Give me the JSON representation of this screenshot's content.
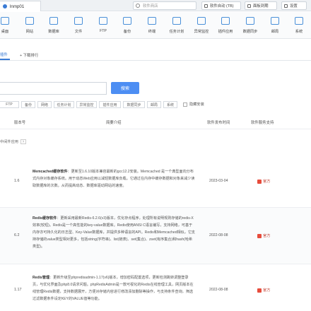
{
  "topbar": {
    "host_tab": "lnmp01",
    "search_placeholder": "软件商店",
    "btn_software_update": "软件自动 (TB)",
    "btn_fav": "面板到期",
    "btn_settings": "设置"
  },
  "toolbar": [
    {
      "label": "桌面",
      "icon": "desktop-icon"
    },
    {
      "label": "网站",
      "icon": "globe-icon"
    },
    {
      "label": "数据库",
      "icon": "database-icon"
    },
    {
      "label": "文件",
      "icon": "folder-icon"
    },
    {
      "label": "FTP",
      "icon": "ftp-icon"
    },
    {
      "label": "备份",
      "icon": "backup-icon"
    },
    {
      "label": "终端",
      "icon": "terminal-icon"
    },
    {
      "label": "任务计划",
      "icon": "clock-icon"
    },
    {
      "label": "异常监控",
      "icon": "monitor-icon"
    },
    {
      "label": "插件应用",
      "icon": "plugin-icon"
    },
    {
      "label": "数据同步",
      "icon": "sync-icon"
    },
    {
      "label": "邮局",
      "icon": "mail-icon"
    },
    {
      "label": "系统",
      "icon": "system-icon"
    }
  ],
  "subtabs": {
    "tab1": "插件",
    "tab2": "+ 下载排行"
  },
  "search": {
    "button": "搜索"
  },
  "chips": [
    "FTP",
    "备份",
    "网络",
    "任务计划",
    "异常监控",
    "插件应用",
    "数据同步",
    "邮局",
    "系统"
  ],
  "checkbox_label": "隐藏安装",
  "table": {
    "col_version": "版本号",
    "col_desc": "简要介绍",
    "col_date": "软件发布时间",
    "col_vendor": "软件服务支持"
  },
  "category": {
    "label": "中间件应用",
    "badge": "?"
  },
  "rows": [
    {
      "version": "1.6",
      "title": "Memcached缓存软件",
      "text": "：更新至1.6.10版本兼容最新的gcc12.2安装。Memcached 是一个典型面向分布式内存对象缓存系统。用于动态Web应用以减轻数据库负载。它通过在内存中缓存数据和对象来减少读取数据库的次数。从而提高动态、数据库驱动网站的速度。",
      "date": "2023-03-04",
      "vendor": "官方"
    },
    {
      "version": "6.2",
      "title": "Redis缓存软件",
      "text": "：更新采用最新Redis-6.2.6(v3)版本，优化存点程序，处理所有说明规则存储的redis-X效率(较短)。Redis是一个高性能的key-value数据库。Redis使用ANSI C语言编写，支持网络，可基于内存亦可持久化的日志型、Key-Value数据库，并提供多种语言的API。Redis和Memcached相似，它支持存储的value类型相对更多，包括string(字符串)、list(链表)、set(集合)、zset(有序集合)和hash(哈希类型)。",
      "date": "2022-08-08",
      "vendor": "官方"
    },
    {
      "version": "1.17",
      "title": "Redis管理",
      "text": "：更新升级至phpredisadmin-1.17(v6)版本，增加密码配置选项，更新检测跳转调整登录页，与优化界面及php8.0请求问题。phpRedisAdmin是一款可视化的Redis在线管理工具，网页版本在线管理Redis数据，支持数据展开，方便对存储内容进行修改添加删除等操作，与支持条件查询，筛选过滤数据条件设定KEY的VALUE值等功能。",
      "date": "2022-08-08",
      "vendor": "官方"
    }
  ],
  "colors": {
    "accent": "#3a7bd5",
    "button": "#4d8ef3",
    "vendor": "#c0392b"
  }
}
